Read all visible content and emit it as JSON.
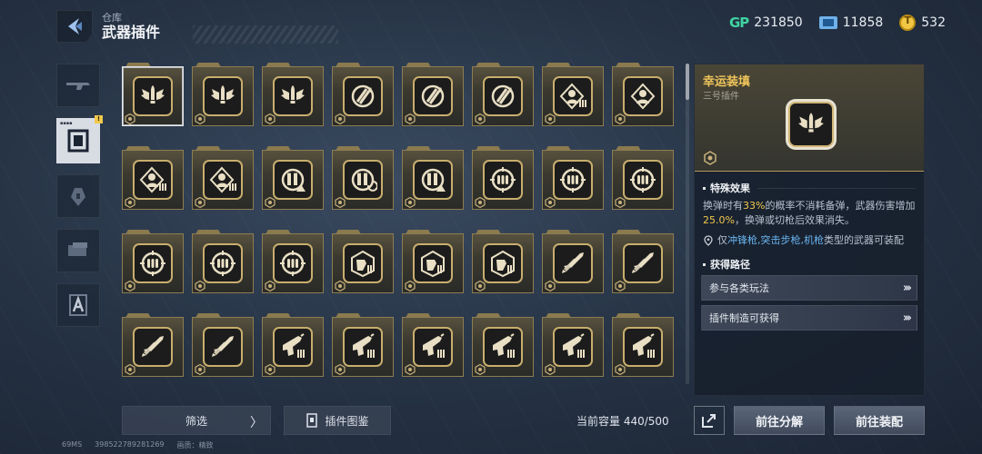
{
  "header": {
    "breadcrumb": "仓库",
    "title": "武器插件"
  },
  "currencies": [
    {
      "icon": "gp-icon",
      "value": "231850"
    },
    {
      "icon": "ticket-icon",
      "value": "11858"
    },
    {
      "icon": "coin-icon",
      "value": "532"
    }
  ],
  "rail": {
    "items": [
      {
        "name": "weapons",
        "icon": "rifle-icon"
      },
      {
        "name": "weapon-plugins",
        "icon": "plugin-chip-icon",
        "active": true,
        "badge": "!"
      },
      {
        "name": "equipment",
        "icon": "grenade-icon"
      },
      {
        "name": "consumables",
        "icon": "ammo-pack-icon"
      },
      {
        "name": "emblems",
        "icon": "badge-a-icon"
      }
    ]
  },
  "grid": {
    "slots": [
      {
        "glyph": "wing",
        "selected": true
      },
      {
        "glyph": "wing"
      },
      {
        "glyph": "wing"
      },
      {
        "glyph": "reload"
      },
      {
        "glyph": "reload"
      },
      {
        "glyph": "reload"
      },
      {
        "glyph": "head-ammo"
      },
      {
        "glyph": "head"
      },
      {
        "glyph": "head-ammo"
      },
      {
        "glyph": "head-ammo"
      },
      {
        "glyph": "bullet-alert"
      },
      {
        "glyph": "bullet-reload"
      },
      {
        "glyph": "bullet-alert"
      },
      {
        "glyph": "target-bullets"
      },
      {
        "glyph": "target-bullets"
      },
      {
        "glyph": "target-bullets"
      },
      {
        "glyph": "target-bullets"
      },
      {
        "glyph": "target-bullets"
      },
      {
        "glyph": "target-bullets"
      },
      {
        "glyph": "mag-hand"
      },
      {
        "glyph": "mag-hand"
      },
      {
        "glyph": "mag-hand"
      },
      {
        "glyph": "rocket"
      },
      {
        "glyph": "rocket"
      },
      {
        "glyph": "rocket"
      },
      {
        "glyph": "rocket"
      },
      {
        "glyph": "gun-ammo"
      },
      {
        "glyph": "gun-ammo"
      },
      {
        "glyph": "gun-ammo"
      },
      {
        "glyph": "gun-ammo"
      },
      {
        "glyph": "gun-ammo"
      },
      {
        "glyph": "gun-ammo"
      }
    ]
  },
  "detail": {
    "name": "幸运装填",
    "subtitle": "三号插件",
    "special_heading": "特殊效果",
    "effect_pre": "换弹时有",
    "effect_pct": "33%",
    "effect_mid": "的概率不消耗备弹，武器伤害增加",
    "effect_dmg": "25.0%",
    "effect_post": "，换弹或切枪后效果消失。",
    "restrict_pre": "仅",
    "restrict_types": "冲锋枪,突击步枪,机枪",
    "restrict_post": "类型的武器可装配",
    "obtain_heading": "获得路径",
    "routes": [
      "参与各类玩法",
      "插件制造可获得"
    ]
  },
  "bottom": {
    "filter": "筛选",
    "codex": "插件图鉴",
    "capacity": "当前容量 440/500",
    "dismantle": "前往分解",
    "equip": "前往装配"
  },
  "footer": {
    "ping": "69MS",
    "uid": "398522789281269",
    "quality": "画质：",
    "quality_value": "精致"
  },
  "colors": {
    "gold": "#f1c65a",
    "highlight_blue": "#6ab6f2",
    "card_border": "#8d7d52"
  }
}
